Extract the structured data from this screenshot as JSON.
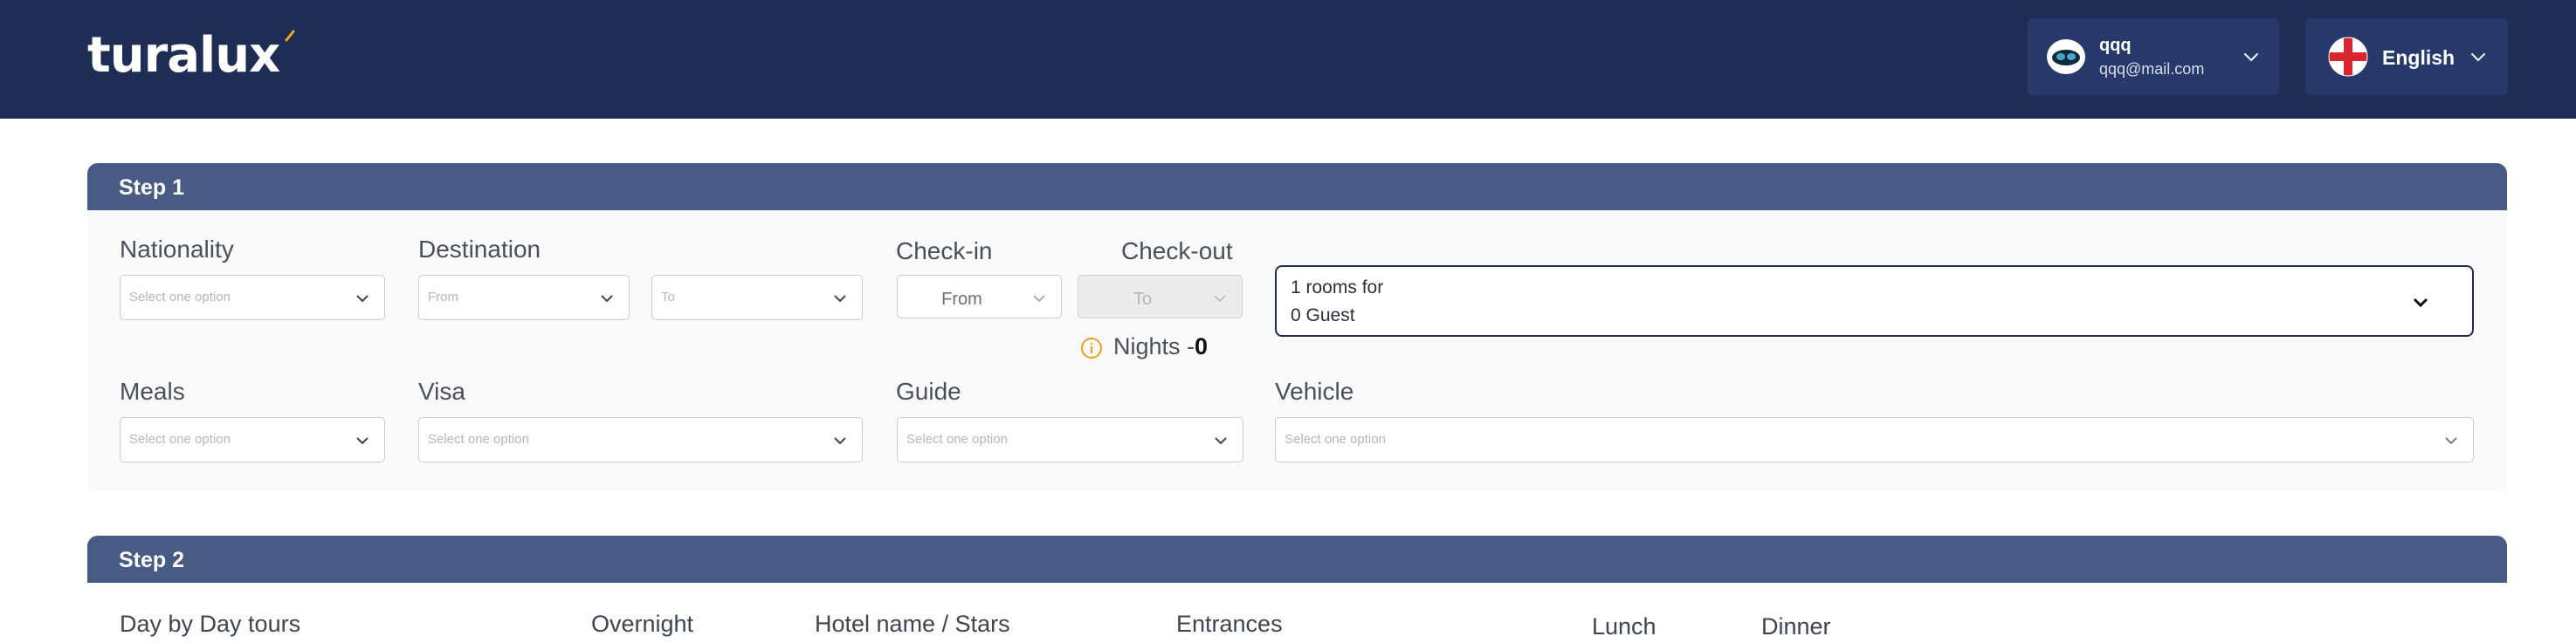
{
  "header": {
    "logo_text": "turalux",
    "user": {
      "name": "qqq",
      "email": "qqq@mail.com",
      "avatar_icon": "avatar-icon"
    },
    "language": {
      "label": "English",
      "flag_icon": "england-flag-icon"
    },
    "colors": {
      "header_bg": "#1d2d54",
      "accent": "#f5a623"
    }
  },
  "step1": {
    "title": "Step 1",
    "nationality": {
      "label": "Nationality",
      "placeholder": "Select one option"
    },
    "destination": {
      "label": "Destination",
      "from_placeholder": "From",
      "to_placeholder": "To"
    },
    "checkin": {
      "label": "Check-in",
      "placeholder": "From"
    },
    "checkout": {
      "label": "Check-out",
      "placeholder": "To"
    },
    "nights": {
      "label": "Nights -",
      "value": "0"
    },
    "rooms": {
      "line1": "1 rooms for",
      "line2": "0 Guest"
    },
    "meals": {
      "label": "Meals",
      "placeholder": "Select one option"
    },
    "visa": {
      "label": "Visa",
      "placeholder": "Select one option"
    },
    "guide": {
      "label": "Guide",
      "placeholder": "Select one option"
    },
    "vehicle": {
      "label": "Vehicle",
      "placeholder": "Select one option"
    }
  },
  "step2": {
    "title": "Step 2",
    "columns": [
      "Day by Day tours",
      "Overnight",
      "Hotel name / Stars",
      "Entrances",
      "Lunch",
      "Dinner"
    ]
  }
}
